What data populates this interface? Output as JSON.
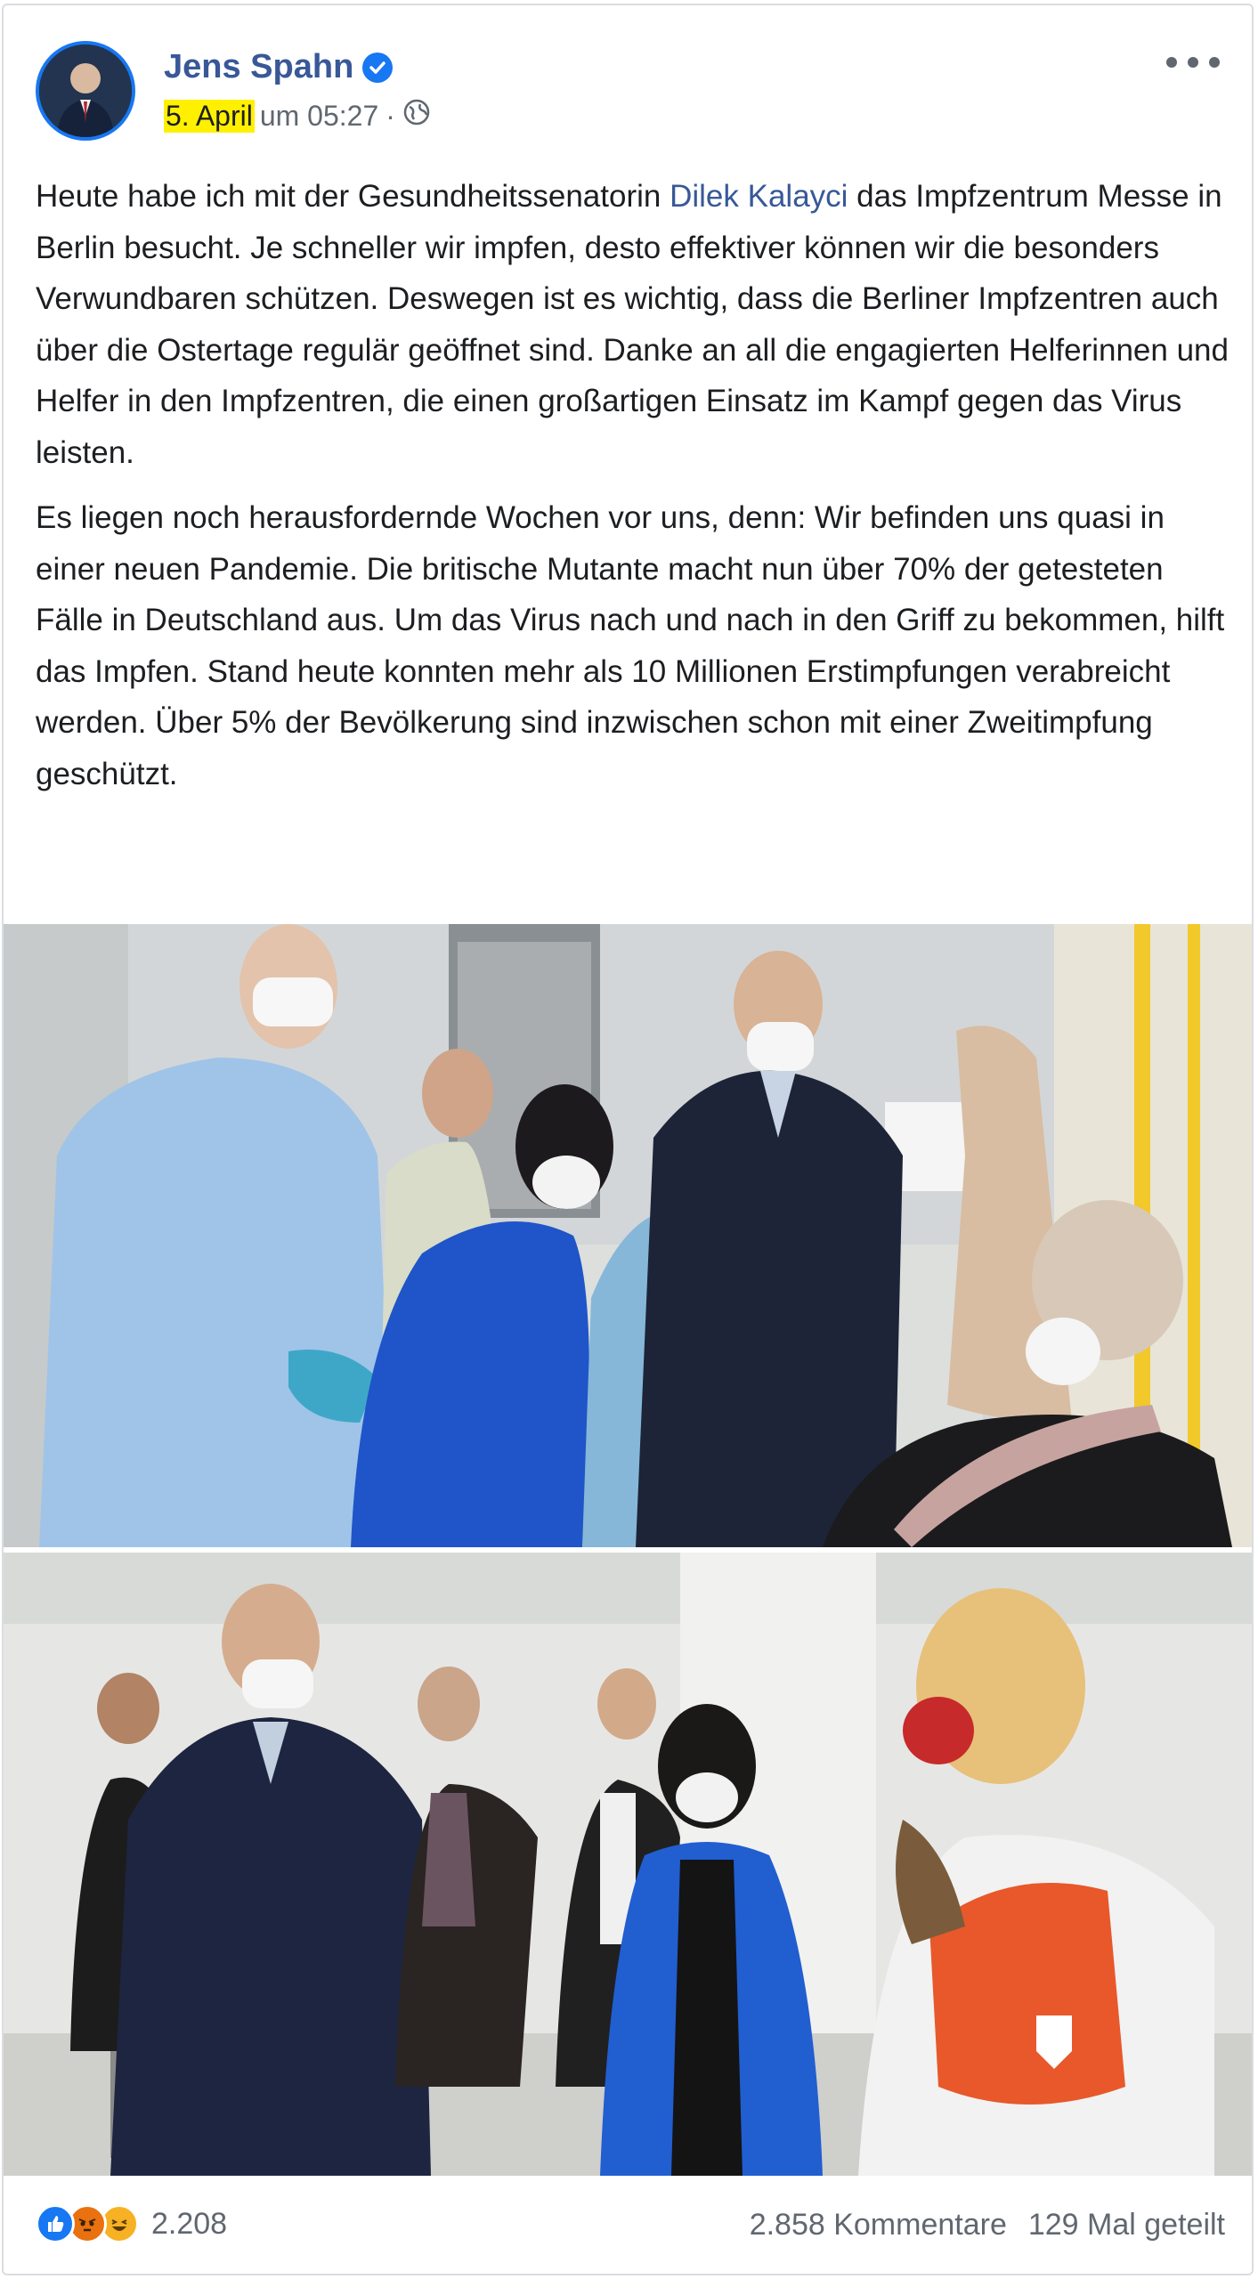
{
  "post": {
    "author": "Jens Spahn",
    "date": "5. April",
    "time": "um 05:27",
    "separator": "·",
    "paragraph1_before": "Heute habe ich mit der Gesundheitssenatorin ",
    "mention": "Dilek Kalayci",
    "paragraph1_after": " das Impfzentrum Messe in Berlin besucht. Je schneller wir impfen, desto effektiver können wir die besonders Verwundbaren schützen. Deswegen ist es wichtig, dass die Berliner Impfzentren auch über die Ostertage regulär geöffnet sind. Danke an all die engagierten Helferinnen und Helfer in den Impfzentren, die einen großartigen Einsatz im Kampf gegen das Virus leisten.",
    "paragraph2": "Es liegen noch herausfordernde Wochen vor uns, denn: Wir befinden uns quasi in einer neuen Pandemie. Die britische Mutante macht nun über 70% der getesteten Fälle in Deutschland aus. Um das Virus nach und nach in den Griff zu bekommen, hilft das Impfen. Stand heute konnten mehr als 10 Millionen Erstimpfungen verabreicht werden. Über 5% der Bevölkerung sind inzwischen schon mit einer Zweitimpfung geschützt."
  },
  "footer": {
    "reactions": [
      "like-icon",
      "angry-icon",
      "haha-icon"
    ],
    "reaction_count": "2.208",
    "comments": "2.858 Kommentare",
    "shares": "129 Mal geteilt"
  },
  "colors": {
    "link": "#385898",
    "meta": "#606770",
    "highlight": "#fff000",
    "verified": "#1877f2"
  }
}
